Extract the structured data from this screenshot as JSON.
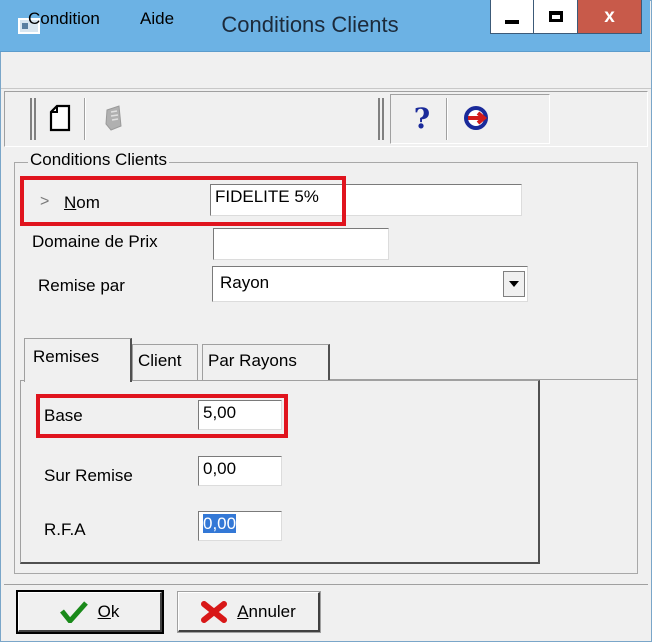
{
  "window": {
    "title": "Conditions Clients",
    "close_glyph": "x"
  },
  "menu": {
    "items": [
      "Condition",
      "Aide"
    ]
  },
  "toolbar": {
    "icons": [
      "new-document-icon",
      "delete-icon",
      "help-icon",
      "exit-icon"
    ],
    "help_glyph": "?"
  },
  "group": {
    "caption": "Conditions Clients"
  },
  "form": {
    "nom_arrow": ">",
    "nom_label_first": "N",
    "nom_label_rest": "om",
    "nom_value": "FIDELITE 5%",
    "domaine_label": "Domaine de Prix",
    "domaine_value": "",
    "remise_label": "Remise par",
    "remise_value": "Rayon"
  },
  "tabs": [
    {
      "label": "Remises",
      "selected": true
    },
    {
      "label": "Client",
      "selected": false
    },
    {
      "label": "Par Rayons",
      "selected": false
    }
  ],
  "remises": {
    "base_label": "Base",
    "base_value": "5,00",
    "surremise_label": "Sur Remise",
    "surremise_value": "0,00",
    "rfa_label": "R.F.A",
    "rfa_value": "0,00"
  },
  "buttons": {
    "ok_first": "O",
    "ok_rest": "k",
    "cancel_first": "A",
    "cancel_rest": "nnuler"
  },
  "colors": {
    "titlebar": "#6cb2e4",
    "highlight": "#e0141e",
    "selection": "#3378d6"
  }
}
